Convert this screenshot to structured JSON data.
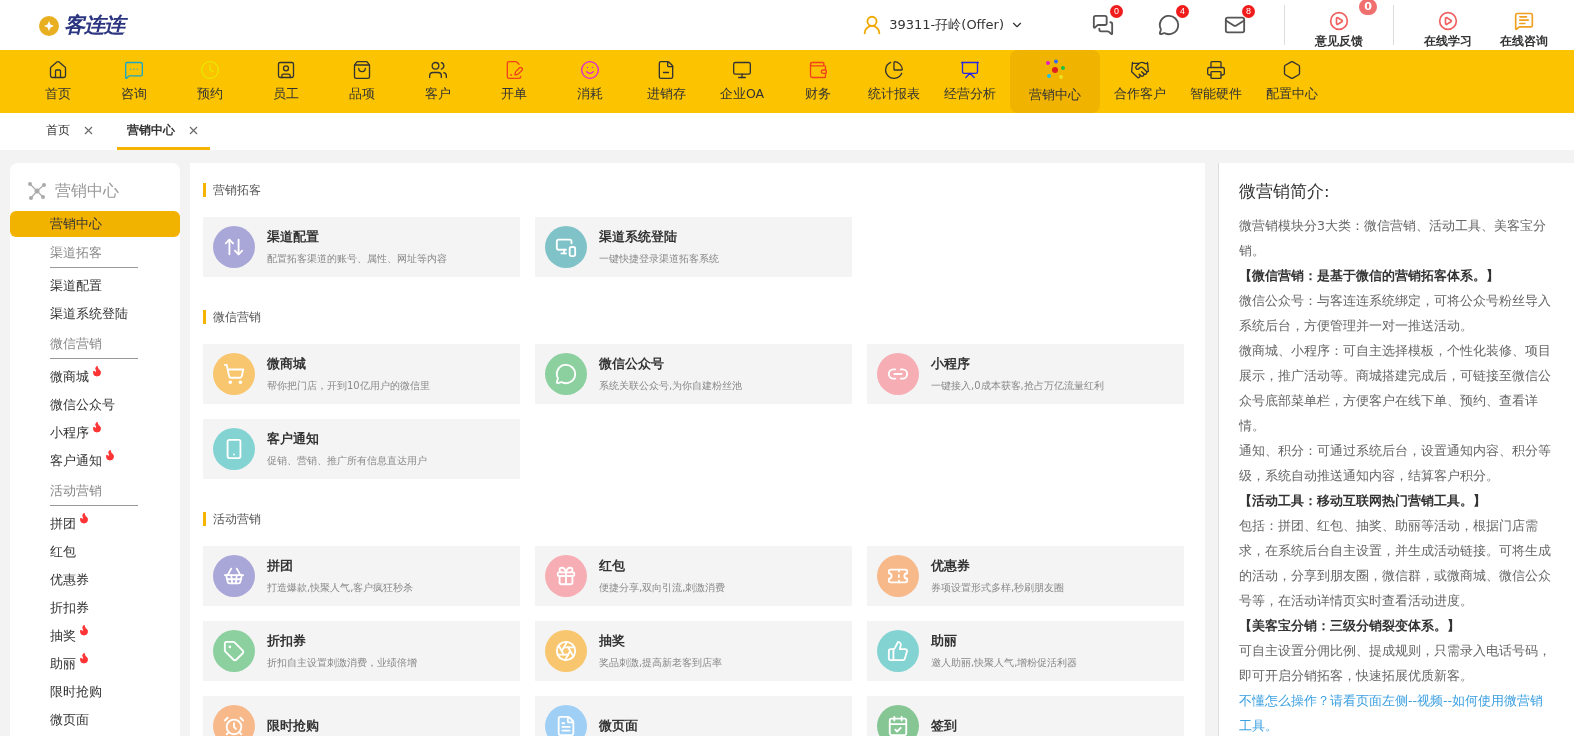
{
  "header": {
    "logo": "客连连",
    "user": "39311-孖岭(Offer)",
    "notifications": [
      {
        "count": "0"
      },
      {
        "count": "4"
      },
      {
        "count": "8"
      }
    ],
    "links": [
      {
        "label": "意见反馈",
        "badge": "0"
      },
      {
        "label": "在线学习"
      },
      {
        "label": "在线咨询"
      }
    ]
  },
  "nav": [
    {
      "label": "首页",
      "selected": false
    },
    {
      "label": "咨询",
      "selected": false
    },
    {
      "label": "预约",
      "selected": false
    },
    {
      "label": "员工",
      "selected": false
    },
    {
      "label": "品项",
      "selected": false
    },
    {
      "label": "客户",
      "selected": false
    },
    {
      "label": "开单",
      "selected": false
    },
    {
      "label": "消耗",
      "selected": false
    },
    {
      "label": "进销存",
      "selected": false
    },
    {
      "label": "企业OA",
      "selected": false
    },
    {
      "label": "财务",
      "selected": false
    },
    {
      "label": "统计报表",
      "selected": false
    },
    {
      "label": "经营分析",
      "selected": false
    },
    {
      "label": "营销中心",
      "selected": true
    },
    {
      "label": "合作客户",
      "selected": false
    },
    {
      "label": "智能硬件",
      "selected": false
    },
    {
      "label": "配置中心",
      "selected": false
    }
  ],
  "tabs": [
    {
      "label": "首页",
      "selected": false
    },
    {
      "label": "营销中心",
      "selected": true
    }
  ],
  "sidebar": {
    "title": "营销中心",
    "items": [
      {
        "kind": "item",
        "label": "营销中心",
        "selected": true,
        "hot": false
      },
      {
        "kind": "header",
        "label": "渠道拓客"
      },
      {
        "kind": "item",
        "label": "渠道配置",
        "selected": false,
        "hot": false
      },
      {
        "kind": "item",
        "label": "渠道系统登陆",
        "selected": false,
        "hot": false
      },
      {
        "kind": "header",
        "label": "微信营销"
      },
      {
        "kind": "item",
        "label": "微商城",
        "selected": false,
        "hot": true
      },
      {
        "kind": "item",
        "label": "微信公众号",
        "selected": false,
        "hot": false
      },
      {
        "kind": "item",
        "label": "小程序",
        "selected": false,
        "hot": true
      },
      {
        "kind": "item",
        "label": "客户通知",
        "selected": false,
        "hot": true
      },
      {
        "kind": "header",
        "label": "活动营销"
      },
      {
        "kind": "item",
        "label": "拼团",
        "selected": false,
        "hot": true
      },
      {
        "kind": "item",
        "label": "红包",
        "selected": false,
        "hot": false
      },
      {
        "kind": "item",
        "label": "优惠券",
        "selected": false,
        "hot": false
      },
      {
        "kind": "item",
        "label": "折扣券",
        "selected": false,
        "hot": false
      },
      {
        "kind": "item",
        "label": "抽奖",
        "selected": false,
        "hot": true
      },
      {
        "kind": "item",
        "label": "助丽",
        "selected": false,
        "hot": true
      },
      {
        "kind": "item",
        "label": "限时抢购",
        "selected": false,
        "hot": false
      },
      {
        "kind": "item",
        "label": "微页面",
        "selected": false,
        "hot": false
      }
    ]
  },
  "sections": [
    {
      "title": "营销拓客",
      "cards": [
        {
          "title": "渠道配置",
          "desc": "配置拓客渠道的账号、属性、网址等内容",
          "color": "#a9a6d8"
        },
        {
          "title": "渠道系统登陆",
          "desc": "一键快捷登录渠道拓客系统",
          "color": "#7fc3c8"
        }
      ]
    },
    {
      "title": "微信营销",
      "cards": [
        {
          "title": "微商城",
          "desc": "帮你把门店，开到10亿用户的微信里",
          "color": "#f8c66e"
        },
        {
          "title": "微信公众号",
          "desc": "系统关联公众号,为你自建粉丝池",
          "color": "#8dd0a0"
        },
        {
          "title": "小程序",
          "desc": "一键接入,0成本获客,抢占万亿流量红利",
          "color": "#f6adb4"
        },
        {
          "title": "客户通知",
          "desc": "促销、营销、推广所有信息直达用户",
          "color": "#84d3d3"
        }
      ]
    },
    {
      "title": "活动营销",
      "cards": [
        {
          "title": "拼团",
          "desc": "打造爆款,快聚人气,客户疯狂秒杀",
          "color": "#a9a6d8"
        },
        {
          "title": "红包",
          "desc": "便捷分享,双向引流,刺激消费",
          "color": "#f6adb4"
        },
        {
          "title": "优惠券",
          "desc": "券项设置形式多样,秒刷朋友圈",
          "color": "#f7b88a"
        },
        {
          "title": "折扣券",
          "desc": "折扣自主设置刺激消费，业绩倍增",
          "color": "#8dd0a0"
        },
        {
          "title": "抽奖",
          "desc": "奖品刺激,提高新老客到店率",
          "color": "#f8c66e"
        },
        {
          "title": "助丽",
          "desc": "邀人助丽,快聚人气,增粉促活利器",
          "color": "#84d3d3"
        },
        {
          "title": "限时抢购",
          "color": "#f7b88a"
        },
        {
          "title": "微页面",
          "color": "#9fcff5"
        },
        {
          "title": "签到",
          "color": "#86c594"
        }
      ]
    }
  ],
  "intro": {
    "title": "微营销简介:",
    "paragraphs": [
      {
        "kind": "text",
        "text": "微营销模块分3大类：微信营销、活动工具、美客宝分销。"
      },
      {
        "kind": "bold",
        "text": "【微信营销：是基于微信的营销拓客体系。】"
      },
      {
        "kind": "text",
        "text": "微信公众号：与客连连系统绑定，可将公众号粉丝导入系统后台，方便管理并一对一推送活动。"
      },
      {
        "kind": "text",
        "text": "微商城、小程序：可自主选择模板，个性化装修、项目展示，推广活动等。商城搭建完成后，可链接至微信公众号底部菜单栏，方便客户在线下单、预约、查看详情。"
      },
      {
        "kind": "text",
        "text": "通知、积分：可通过系统后台，设置通知内容、积分等级，系统自动推送通知内容，结算客户积分。"
      },
      {
        "kind": "bold",
        "text": "【活动工具：移动互联网热门营销工具。】"
      },
      {
        "kind": "text",
        "text": "包括：拼团、红包、抽奖、助丽等活动，根据门店需求，在系统后台自主设置，并生成活动链接。可将生成的活动，分享到朋友圈，微信群，或微商城、微信公众号等，在活动详情页实时查看活动进度。"
      },
      {
        "kind": "bold",
        "text": "【美客宝分销：三级分销裂变体系。】"
      },
      {
        "kind": "text",
        "text": "可自主设置分佣比例、提成规则，只需录入电话号码，即可开启分销拓客，快速拓展优质新客。"
      },
      {
        "kind": "link",
        "text": "不懂怎么操作？请看页面左侧--视频--如何使用微营销工具。"
      }
    ]
  }
}
